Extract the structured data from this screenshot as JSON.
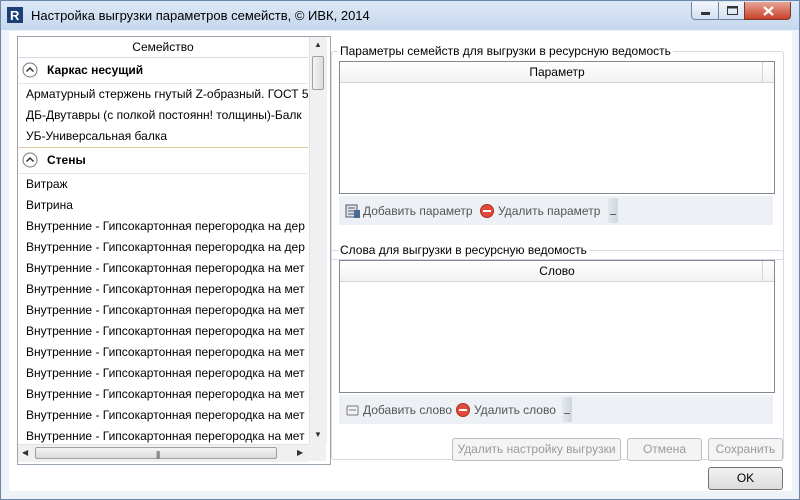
{
  "window": {
    "title": "Настройка выгрузки параметров семейств, © ИВК, 2014",
    "controls": [
      "minimize-icon",
      "maximize-icon",
      "close-icon"
    ]
  },
  "family_list": {
    "header": "Семейство",
    "groups": [
      {
        "name": "Каркас несущий",
        "items": [
          "Арматурный стержень гнутый Z-образный. ГОСТ 5",
          "ДБ-Двутавры (с полкой постоянн! толщины)-Балк",
          "УБ-Универсальная балка"
        ]
      },
      {
        "name": "Стены",
        "items": [
          "Витраж",
          "Витрина",
          "Внутренние - Гипсокартонная перегородка на дер",
          "Внутренние - Гипсокартонная перегородка на дер",
          "Внутренние - Гипсокартонная перегородка на мет",
          "Внутренние - Гипсокартонная перегородка на мет",
          "Внутренние - Гипсокартонная перегородка на мет",
          "Внутренние - Гипсокартонная перегородка на мет",
          "Внутренние - Гипсокартонная перегородка на мет",
          "Внутренние - Гипсокартонная перегородка на мет",
          "Внутренние - Гипсокартонная перегородка на мет",
          "Внутренние - Гипсокартонная перегородка на мет",
          "Внутренние - Гипсокартонная перегородка на мет"
        ]
      }
    ]
  },
  "params_section": {
    "legend": "Параметры семейств для выгрузки в ресурсную ведомость",
    "column": "Параметр",
    "add_label": "Добавить параметр",
    "remove_label": "Удалить параметр"
  },
  "words_section": {
    "legend": "Слова для выгрузки в ресурсную ведомость",
    "column": "Слово",
    "add_label": "Добавить слово",
    "remove_label": "Удалить слово"
  },
  "buttons": {
    "delete_config": "Удалить настройку выгрузки",
    "cancel": "Отмена",
    "save": "Сохранить",
    "ok": "OK"
  },
  "colors": {
    "titlebar": "#c6d8ee",
    "close_button": "#c7412a",
    "group_separator": "#e0c89a"
  }
}
